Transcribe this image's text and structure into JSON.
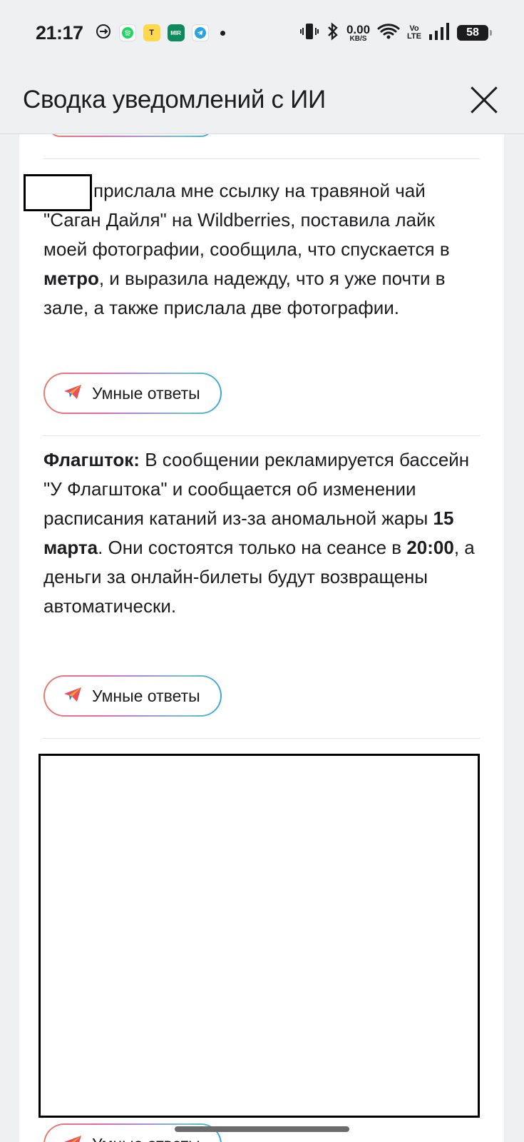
{
  "status_bar": {
    "time": "21:17",
    "net_speed_value": "0.00",
    "net_speed_unit": "KB/S",
    "volte_top": "Vo",
    "volte_bottom": "LTE",
    "battery": "58",
    "icons": [
      "data-saver-icon",
      "spotify-icon",
      "yellow-app-icon",
      "mir-pay-icon",
      "telegram-icon",
      "notification-dot-icon",
      "vibrate-icon",
      "bluetooth-icon",
      "wifi-icon",
      "signal-icon",
      "battery-icon"
    ]
  },
  "header": {
    "title": "Сводка уведомлений с ИИ"
  },
  "summaries": [
    {
      "sender": "",
      "text_before": "прислала мне ссылку на травяной чай \"Саган Дайля\" на Wildberries, поставила лайк моей фотографии, сообщила, что спускается в ",
      "bold_1": "метро",
      "text_after": ", и выразила надежду, что я уже почти в зале, а также прислала две фотографии."
    },
    {
      "sender": "Флагшток:",
      "text_1": " В сообщении рекламируется бассейн \"У Флагштока\" и сообщается об изменении расписания катаний из-за аномальной жары ",
      "bold_1": "15 марта",
      "text_2": ". Они состоятся только на сеансе в ",
      "bold_2": "20:00",
      "text_3": ", а деньги за онлайн-билеты будут возвращены автоматически."
    }
  ],
  "smart_reply_label": "Умные ответы",
  "colors": {
    "background": "#eef0f2",
    "card": "#ffffff",
    "text": "#1c1c1e",
    "gradient": [
      "#e87c6a",
      "#e46aa8",
      "#a78be0",
      "#6fc2c4",
      "#3fa7e0"
    ]
  }
}
